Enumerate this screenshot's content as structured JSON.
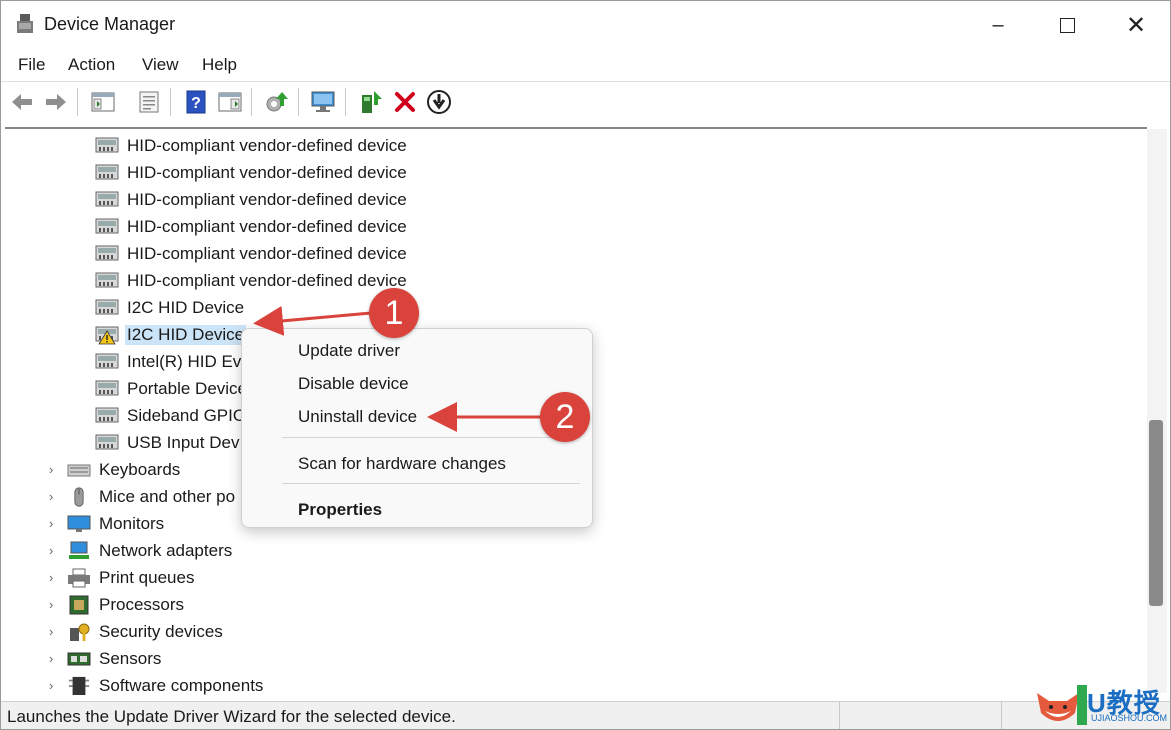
{
  "window": {
    "title": "Device Manager"
  },
  "menus": [
    "File",
    "Action",
    "View",
    "Help"
  ],
  "toolbar": [
    {
      "name": "back-icon",
      "enabled": false
    },
    {
      "name": "forward-icon",
      "enabled": false
    },
    {
      "name": "show-hide-console-tree-icon",
      "enabled": true
    },
    {
      "name": "properties-icon",
      "enabled": true
    },
    {
      "name": "help-icon",
      "enabled": true
    },
    {
      "name": "view-icon",
      "enabled": true
    },
    {
      "name": "update-driver-icon",
      "enabled": true
    },
    {
      "name": "scan-hardware-icon",
      "enabled": true
    },
    {
      "name": "enable-device-icon",
      "enabled": true
    },
    {
      "name": "uninstall-icon",
      "enabled": true
    },
    {
      "name": "disable-device-icon",
      "enabled": true
    }
  ],
  "tree": [
    {
      "label": "HID-compliant vendor-defined device",
      "icon": "hid-device-icon",
      "warn": false
    },
    {
      "label": "HID-compliant vendor-defined device",
      "icon": "hid-device-icon",
      "warn": false
    },
    {
      "label": "HID-compliant vendor-defined device",
      "icon": "hid-device-icon",
      "warn": false
    },
    {
      "label": "HID-compliant vendor-defined device",
      "icon": "hid-device-icon",
      "warn": false
    },
    {
      "label": "HID-compliant vendor-defined device",
      "icon": "hid-device-icon",
      "warn": false
    },
    {
      "label": "HID-compliant vendor-defined device",
      "icon": "hid-device-icon",
      "warn": false
    },
    {
      "label": "I2C HID Device",
      "icon": "hid-device-icon",
      "warn": false
    },
    {
      "label": "I2C HID Device",
      "icon": "hid-warning-icon",
      "warn": true,
      "selected": true
    },
    {
      "label": "Intel(R) HID Eve",
      "icon": "hid-device-icon",
      "warn": false
    },
    {
      "label": "Portable Device",
      "icon": "hid-device-icon",
      "warn": false
    },
    {
      "label": "Sideband GPIO",
      "icon": "hid-device-icon",
      "warn": false
    },
    {
      "label": "USB Input Dev",
      "icon": "hid-device-icon",
      "warn": false
    }
  ],
  "categories": [
    {
      "label": "Keyboards",
      "icon": "keyboard-icon"
    },
    {
      "label": "Mice and other po",
      "icon": "mouse-icon"
    },
    {
      "label": "Monitors",
      "icon": "monitor-icon"
    },
    {
      "label": "Network adapters",
      "icon": "network-adapter-icon"
    },
    {
      "label": "Print queues",
      "icon": "printer-icon"
    },
    {
      "label": "Processors",
      "icon": "processor-icon"
    },
    {
      "label": "Security devices",
      "icon": "security-key-icon"
    },
    {
      "label": "Sensors",
      "icon": "sensor-icon"
    },
    {
      "label": "Software components",
      "icon": "software-component-icon"
    }
  ],
  "context_menu": {
    "update": "Update driver",
    "disable": "Disable device",
    "uninstall": "Uninstall device",
    "scan": "Scan for hardware changes",
    "properties": "Properties"
  },
  "callouts": [
    "1",
    "2"
  ],
  "status": "Launches the Update Driver Wizard for the selected device.",
  "watermark": {
    "text": "U教授",
    "sub": "UJIAOSHOU.COM"
  },
  "colors": {
    "callout": "#d9433c",
    "selection": "#cce4f7",
    "uninstall_red": "#d0021b"
  }
}
